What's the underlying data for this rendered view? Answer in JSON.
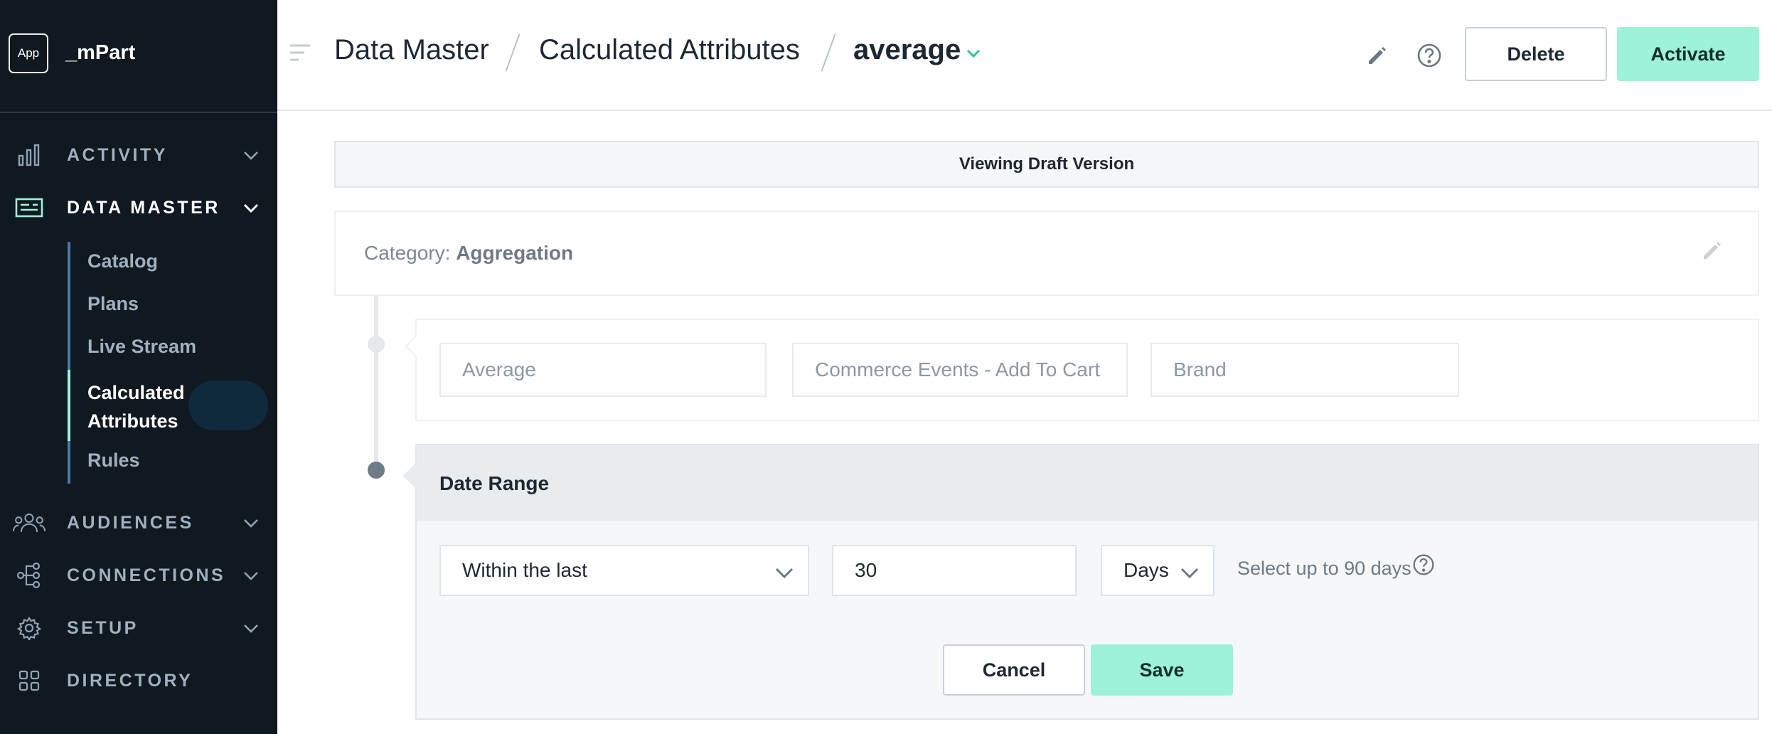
{
  "app": {
    "badge": "App",
    "name": "_mPart"
  },
  "sidebar": {
    "nav": [
      {
        "label": "ACTIVITY",
        "icon": "bar-chart-icon"
      },
      {
        "label": "DATA MASTER",
        "icon": "data-master-icon",
        "active": true
      },
      {
        "label": "AUDIENCES",
        "icon": "people-icon"
      },
      {
        "label": "CONNECTIONS",
        "icon": "connections-icon"
      },
      {
        "label": "SETUP",
        "icon": "gear-icon"
      },
      {
        "label": "DIRECTORY",
        "icon": "grid-icon"
      }
    ],
    "sub_items": [
      "Catalog",
      "Plans",
      "Live Stream",
      "Calculated Attributes",
      "Rules"
    ],
    "active_sub_line1": "Calculated",
    "active_sub_line2": "Attributes"
  },
  "header": {
    "breadcrumb": [
      "Data Master",
      "Calculated Attributes",
      "average"
    ],
    "delete_label": "Delete",
    "activate_label": "Activate"
  },
  "banner": {
    "text": "Viewing Draft Version"
  },
  "category": {
    "label": "Category:",
    "value": "Aggregation"
  },
  "step": {
    "fields": [
      "Average",
      "Commerce Events - Add To Cart",
      "Brand"
    ]
  },
  "date_range": {
    "title": "Date Range",
    "operator": "Within the last",
    "amount": "30",
    "unit": "Days",
    "hint": "Select up to 90 days",
    "cancel_label": "Cancel",
    "save_label": "Save"
  },
  "colors": {
    "accent": "#9ef2d8",
    "sidebar_bg": "#101820",
    "active_line": "#4a79a8"
  }
}
